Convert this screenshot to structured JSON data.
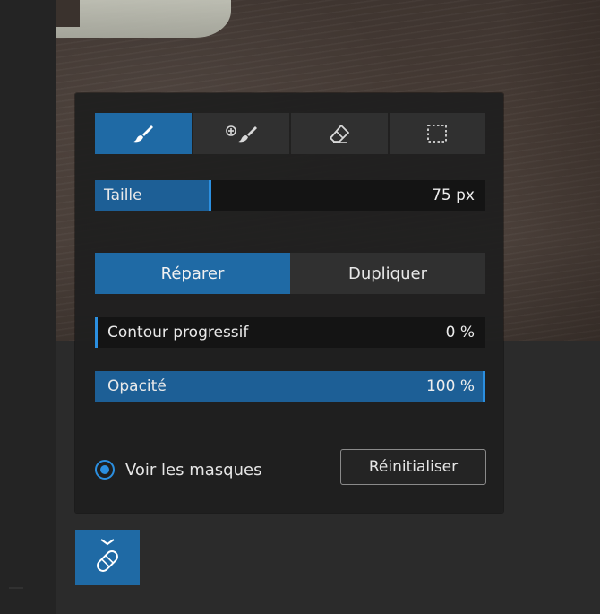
{
  "tools": [
    {
      "name": "brush-icon",
      "active": true
    },
    {
      "name": "clone-brush-icon",
      "active": false
    },
    {
      "name": "eraser-icon",
      "active": false
    },
    {
      "name": "selection-rect-icon",
      "active": false
    }
  ],
  "size": {
    "label": "Taille",
    "value": "75 px",
    "level": 0.3
  },
  "mode": {
    "options": [
      "Réparer",
      "Dupliquer"
    ],
    "selected": "Réparer"
  },
  "feather": {
    "label": "Contour progressif",
    "value": "0 %",
    "level": 0.0
  },
  "opacity": {
    "label": "Opacité",
    "value": "100 %",
    "level": 1.0
  },
  "show_masks": {
    "label": "Voir les masques",
    "checked": true
  },
  "reset": {
    "label": "Réinitialiser"
  },
  "heal_tool": {
    "icon": "bandage-icon",
    "chevron": "chevron-down-icon"
  },
  "colors": {
    "accent": "#1f6aa5",
    "accent_bright": "#2b8fe0"
  }
}
